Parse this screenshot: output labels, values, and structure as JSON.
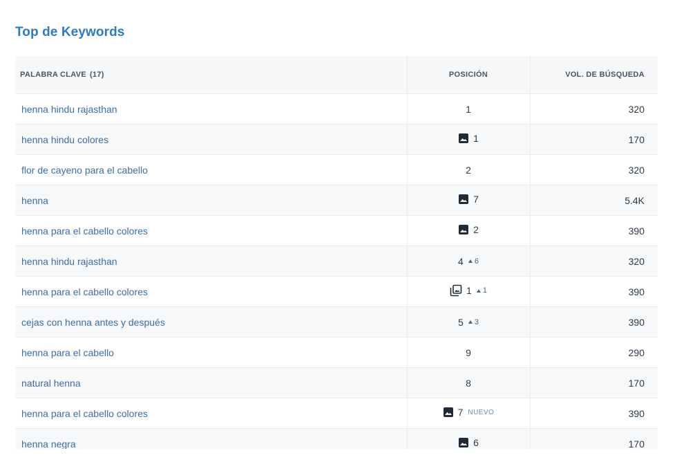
{
  "section": {
    "title": "Top de Keywords"
  },
  "table": {
    "headers": {
      "keyword": "PALABRA CLAVE",
      "keyword_count": "(17)",
      "position": "POSICIÓN",
      "volume": "VOL. DE BÚSQUEDA"
    },
    "rows": [
      {
        "keyword": "henna hindu rajasthan",
        "position": "1",
        "feature": "",
        "change": "",
        "badge": "",
        "volume": "320"
      },
      {
        "keyword": "henna hindu colores",
        "position": "1",
        "feature": "image-icon",
        "change": "",
        "badge": "",
        "volume": "170"
      },
      {
        "keyword": "flor de cayeno para el cabello",
        "position": "2",
        "feature": "",
        "change": "",
        "badge": "",
        "volume": "320"
      },
      {
        "keyword": "henna",
        "position": "7",
        "feature": "image-icon",
        "change": "",
        "badge": "",
        "volume": "5.4K"
      },
      {
        "keyword": "henna para el cabello colores",
        "position": "2",
        "feature": "image-icon",
        "change": "",
        "badge": "",
        "volume": "390"
      },
      {
        "keyword": "henna hindu rajasthan",
        "position": "4",
        "feature": "",
        "change": "6",
        "badge": "",
        "volume": "320"
      },
      {
        "keyword": "henna para el cabello colores",
        "position": "1",
        "feature": "image-pack-icon",
        "change": "1",
        "badge": "",
        "volume": "390"
      },
      {
        "keyword": "cejas con henna antes y después",
        "position": "5",
        "feature": "",
        "change": "3",
        "badge": "",
        "volume": "390"
      },
      {
        "keyword": "henna para el cabello",
        "position": "9",
        "feature": "",
        "change": "",
        "badge": "",
        "volume": "290"
      },
      {
        "keyword": "natural henna",
        "position": "8",
        "feature": "",
        "change": "",
        "badge": "",
        "volume": "170"
      },
      {
        "keyword": "henna para el cabello colores",
        "position": "7",
        "feature": "image-icon",
        "change": "",
        "badge": "NUEVO",
        "volume": "390"
      },
      {
        "keyword": "henna negra",
        "position": "6",
        "feature": "image-icon",
        "change": "",
        "badge": "",
        "volume": "170"
      }
    ]
  },
  "colors": {
    "title": "#2b7bc3",
    "link": "#3a6ea5",
    "header_bg": "#f6f7f9",
    "icon": "#1f2a36"
  }
}
